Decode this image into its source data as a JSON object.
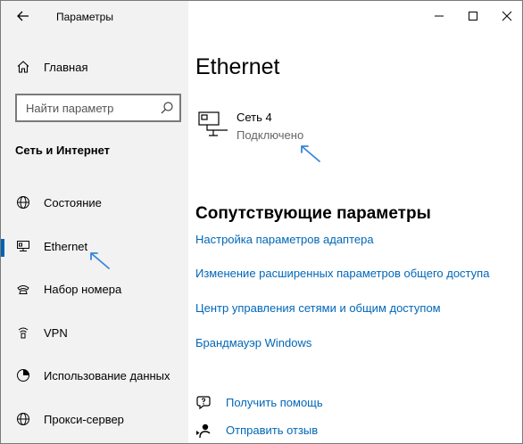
{
  "window": {
    "title": "Параметры"
  },
  "sidebar": {
    "home_label": "Главная",
    "search_placeholder": "Найти параметр",
    "section_title": "Сеть и Интернет",
    "items": [
      {
        "label": "Состояние",
        "icon": "globe-icon"
      },
      {
        "label": "Ethernet",
        "icon": "ethernet-icon",
        "active": true
      },
      {
        "label": "Набор номера",
        "icon": "dial-up-icon"
      },
      {
        "label": "VPN",
        "icon": "vpn-icon"
      },
      {
        "label": "Использование данных",
        "icon": "data-usage-icon"
      },
      {
        "label": "Прокси-сервер",
        "icon": "globe-icon"
      }
    ]
  },
  "main": {
    "title": "Ethernet",
    "network": {
      "name": "Сеть 4",
      "status": "Подключено"
    },
    "related_title": "Сопутствующие параметры",
    "links": [
      "Настройка параметров адаптера",
      "Изменение расширенных параметров общего доступа",
      "Центр управления сетями и общим доступом",
      "Брандмауэр Windows"
    ],
    "help": {
      "get_help": "Получить помощь",
      "feedback": "Отправить отзыв"
    }
  },
  "colors": {
    "accent": "#0063b1",
    "link": "#0067b8",
    "sidebar_bg": "#f2f2f2",
    "annotation": "#3a86d6"
  }
}
